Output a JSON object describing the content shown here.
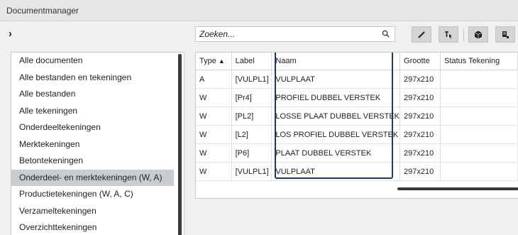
{
  "window": {
    "title": "Documentmanager"
  },
  "toolbar": {
    "expand_icon": "chevron-right-icon",
    "search_placeholder": "Zoeken...",
    "buttons": [
      "pencil-icon",
      "cursor-select-icon",
      "cube-icon",
      "properties-icon"
    ]
  },
  "sidebar": {
    "items": [
      "Alle documenten",
      "Alle bestanden en tekeningen",
      "Alle bestanden",
      "Alle tekeningen",
      "Onderdeeltekeningen",
      "Merktekeningen",
      "Betontekeningen",
      "Onderdeel- en merktekeningen (W, A)",
      "Productietekeningen (W, A, C)",
      "Verzameltekeningen",
      "Overzichttekeningen"
    ],
    "selected_index": 7
  },
  "table": {
    "columns": [
      "Type",
      "Label",
      "Naam",
      "Grootte",
      "Status Tekening"
    ],
    "sort_column": "Type",
    "sort_direction": "ascending",
    "rows": [
      [
        "A",
        "[VULPL1]",
        "VULPLAAT",
        "297x210",
        ""
      ],
      [
        "W",
        "[Pr4]",
        "PROFIEL DUBBEL VERSTEK",
        "297x210",
        ""
      ],
      [
        "W",
        "[PL2]",
        "LOSSE PLAAT DUBBEL VERSTEK",
        "297x210",
        ""
      ],
      [
        "W",
        "[L2]",
        "LOS PROFIEL DUBBEL VERSTEK",
        "297x210",
        ""
      ],
      [
        "W",
        "[P6]",
        "PLAAT DUBBEL VERSTEK",
        "297x210",
        ""
      ],
      [
        "W",
        "[VULPL1]",
        "VULPLAAT",
        "297x210",
        ""
      ]
    ]
  },
  "colors": {
    "highlight": "#1b3a5e",
    "selected_row": "#c9cdd2"
  }
}
